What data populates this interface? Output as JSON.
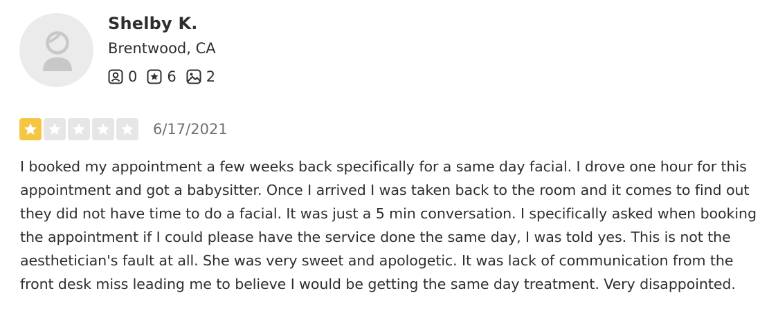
{
  "reviewer": {
    "name": "Shelby K.",
    "location": "Brentwood, CA",
    "avatar_icon": "default-user-avatar-icon",
    "stats": [
      {
        "icon": "friends-icon",
        "value": "0"
      },
      {
        "icon": "reviews-icon",
        "value": "6"
      },
      {
        "icon": "photos-icon",
        "value": "2"
      }
    ]
  },
  "review": {
    "rating": 1,
    "rating_max": 5,
    "star_color_filled": "#f5c643",
    "star_color_empty": "#e6e6e6",
    "date": "6/17/2021",
    "text": "I booked my appointment a few weeks back specifically for a same day facial. I drove one hour for this appointment and got a babysitter. Once I arrived I was taken back to the room and it comes to find out they did not have time to do a facial. It was just a 5 min conversation. I specifically asked when booking the appointment if I could please have the service done the same day, I was told yes. This is not the aesthetician's fault at all. She was very sweet and apologetic. It was lack of communication from the front desk miss leading me to believe I would be getting the same day treatment. Very disappointed."
  }
}
